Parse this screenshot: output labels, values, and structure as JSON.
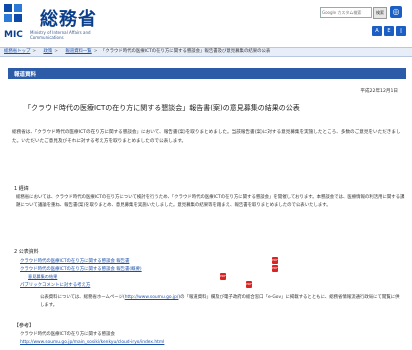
{
  "header": {
    "title": "総務省",
    "mic": "MIC",
    "subtitle": "Ministry of Internal Affairs and Communications",
    "search_placeholder": "Google カスタム検索",
    "search_button": "検索",
    "colors": {
      "brand": "#0b3f8c",
      "accent": "#2c5ca8",
      "link": "#1a4fa8"
    }
  },
  "breadcrumb": [
    "総務省トップ",
    "政策",
    "報道資料一覧"
  ],
  "breadcrumb_current": "「クラウド時代の医療ICTの在り方に関する懇談会」報告書及び意見募集の結果の公表",
  "section_label": "報道資料",
  "date": "平成22年12月1日",
  "page_title": "「クラウド時代の医療ICTの在り方に関する懇談会」報告書(案)の意見募集の結果の公表",
  "lede": "総務省は、「クラウド時代の医療ICTの在り方に関する懇談会」において、報告書(案)を取りまとめました。当該報告書(案)に対する意見募集を実施したところ、多数のご意見をいただきました。いただいたご意見及びそれに対する考え方を取りまとめましたので公表します。",
  "sections": {
    "one_title": "1 経緯",
    "one_text": "総務省においては、クラウド時代の医療ICTの在り方について検討を行うため、「クラウド時代の医療ICTの在り方に関する懇談会」を開催しております。本懇談会では、医療情報の利活用に関する課題について議論を重ね、報告書(案)を取りまとめ、意見募集を実施いたしました。意見募集の結果等を踏まえ、報告書を取りまとめましたので公表いたします。",
    "two_title": "2 公表資料",
    "resources": [
      "クラウド時代の医療ICTの在り方に関する懇談会 報告書",
      "クラウド時代の医療ICTの在り方に関する懇談会 報告書(概要)",
      "意見募集の結果",
      "パブリックコメントに対する考え方"
    ],
    "note_text": "公表資料については、総務省ホームページ(",
    "note_link": "http://www.soumu.go.jp/",
    "note_tail": ")の「報道資料」欄及び電子政府の総合窓口「e-Gov」に掲載するとともに、総務省情報流通行政局にて閲覧に供します。",
    "three_title": "【参考】",
    "ref1": "クラウド時代の医療ICTの在り方に関する懇談会",
    "ref2": "http://www.soumu.go.jp/main_sosiki/kenkyu/cloud-iryo/index.html"
  },
  "icons": {
    "pdf": "pdf-icon",
    "search": "search-icon",
    "globe": "globe-icon"
  }
}
